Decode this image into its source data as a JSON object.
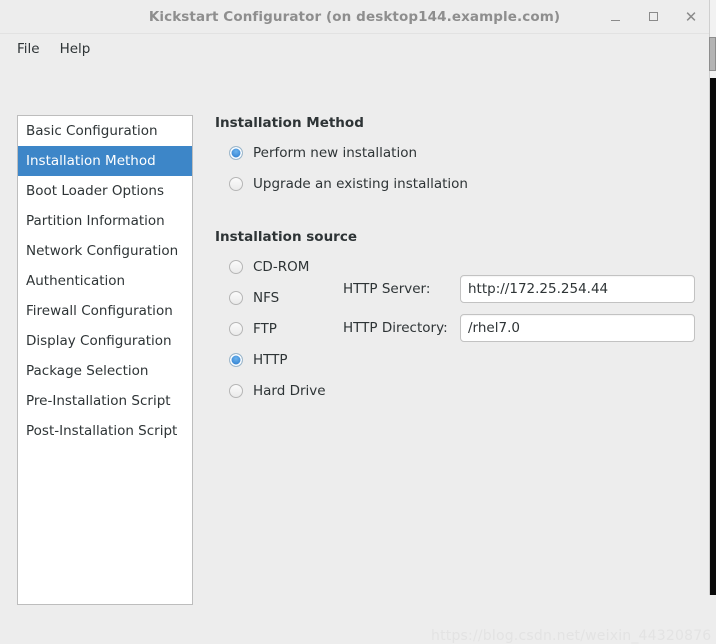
{
  "window": {
    "title": "Kickstart Configurator (on desktop144.example.com)",
    "controls": {
      "minimize": "minimize-button",
      "maximize": "maximize-button",
      "close": "close-button",
      "close_glyph": "✕"
    }
  },
  "menu": {
    "items": [
      {
        "label": "File"
      },
      {
        "label": "Help"
      }
    ]
  },
  "sidebar": {
    "items": [
      {
        "label": "Basic Configuration",
        "selected": false
      },
      {
        "label": "Installation Method",
        "selected": true
      },
      {
        "label": "Boot Loader Options",
        "selected": false
      },
      {
        "label": "Partition Information",
        "selected": false
      },
      {
        "label": "Network Configuration",
        "selected": false
      },
      {
        "label": "Authentication",
        "selected": false
      },
      {
        "label": "Firewall Configuration",
        "selected": false
      },
      {
        "label": "Display Configuration",
        "selected": false
      },
      {
        "label": "Package Selection",
        "selected": false
      },
      {
        "label": "Pre-Installation Script",
        "selected": false
      },
      {
        "label": "Post-Installation Script",
        "selected": false
      }
    ]
  },
  "main": {
    "installation_method": {
      "title": "Installation Method",
      "options": [
        {
          "label": "Perform new installation",
          "checked": true
        },
        {
          "label": "Upgrade an existing installation",
          "checked": false
        }
      ]
    },
    "installation_source": {
      "title": "Installation source",
      "options": [
        {
          "label": "CD-ROM",
          "checked": false
        },
        {
          "label": "NFS",
          "checked": false
        },
        {
          "label": "FTP",
          "checked": false
        },
        {
          "label": "HTTP",
          "checked": true
        },
        {
          "label": "Hard Drive",
          "checked": false
        }
      ],
      "fields": [
        {
          "label": "HTTP Server:",
          "value": "http://172.25.254.44",
          "placeholder": ""
        },
        {
          "label": "HTTP Directory:",
          "value": "/rhel7.0",
          "placeholder": ""
        }
      ]
    }
  },
  "watermark": {
    "text": "https://blog.csdn.net/weixin_44320876"
  },
  "colors": {
    "selection_blue": "#3d86c8",
    "window_bg": "#ededed",
    "panel_bg": "#ffffff",
    "text": "#2e3436",
    "title_text": "#8e8e8e"
  }
}
